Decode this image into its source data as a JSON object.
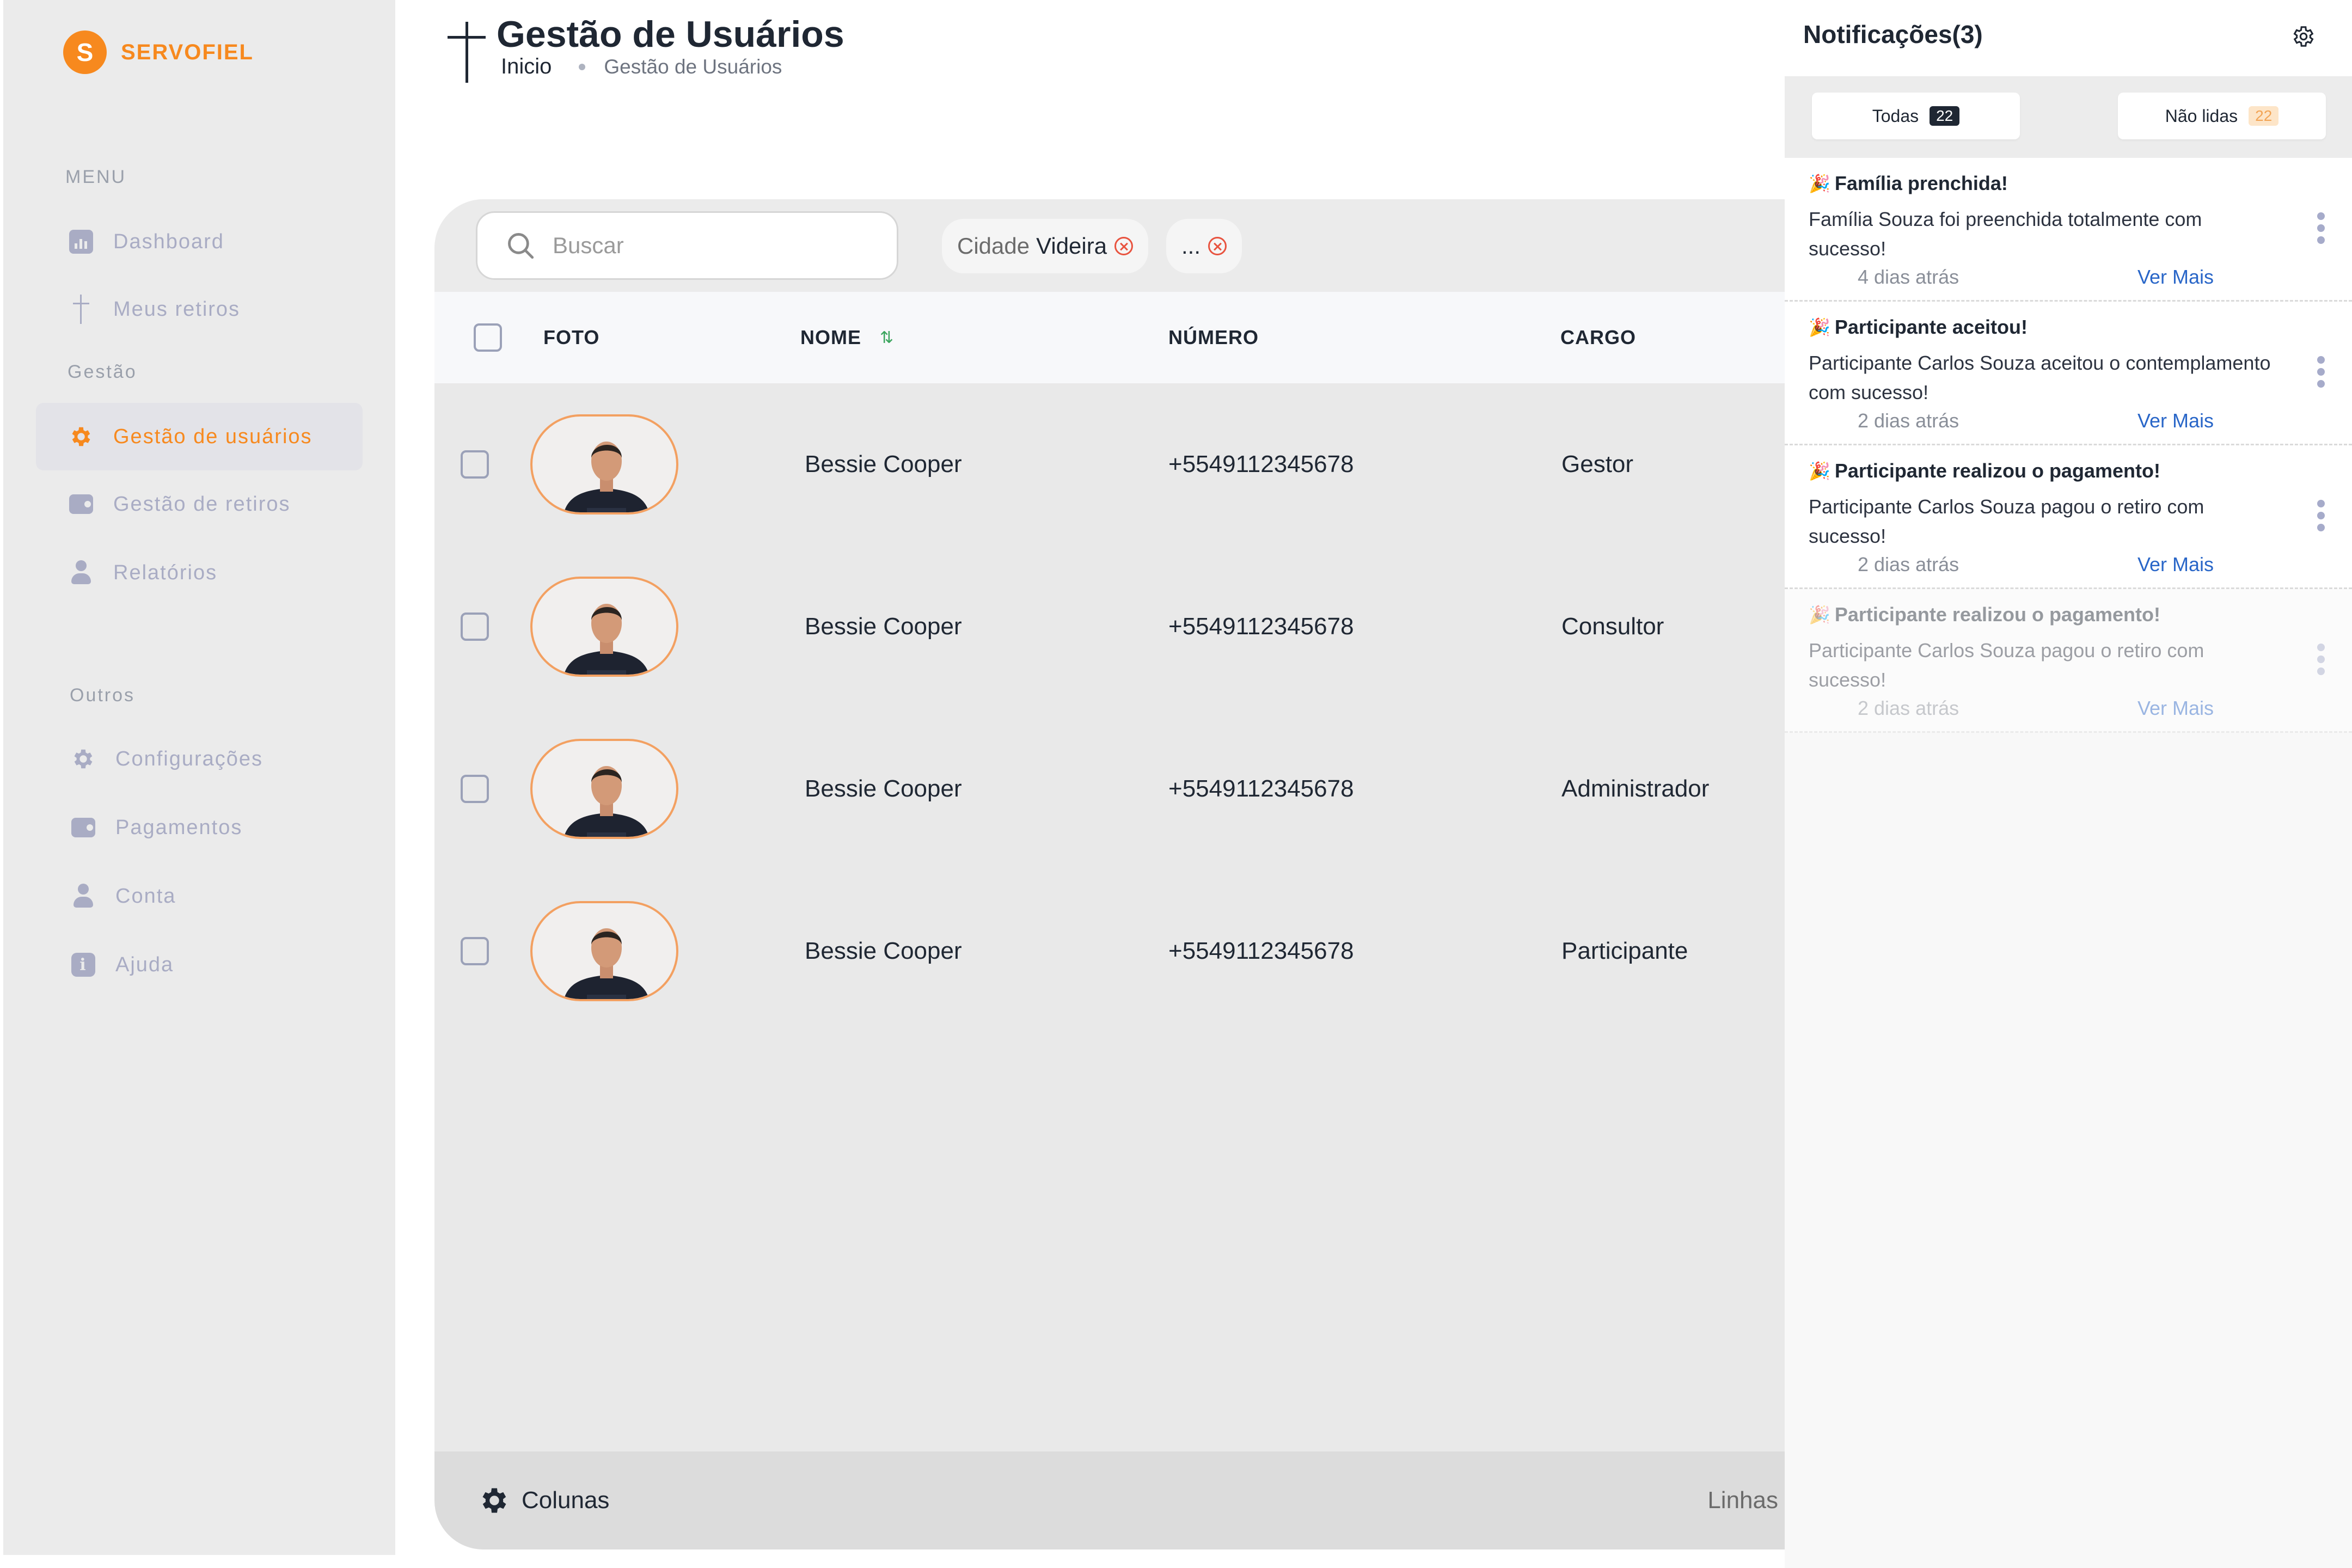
{
  "brand": {
    "initial": "S",
    "name": "SERVOFIEL"
  },
  "sidebar": {
    "menu_label": "MENU",
    "gestao_label": "Gestão",
    "outros_label": "Outros",
    "items": [
      {
        "label": "Dashboard",
        "icon": "chart-icon"
      },
      {
        "label": "Meus retiros",
        "icon": "cross-icon"
      },
      {
        "label": "Gestão de usuários",
        "icon": "gear-icon",
        "active": true
      },
      {
        "label": "Gestão de retiros",
        "icon": "wallet-icon"
      },
      {
        "label": "Relatórios",
        "icon": "user-icon"
      },
      {
        "label": "Configurações",
        "icon": "gear-icon"
      },
      {
        "label": "Pagamentos",
        "icon": "wallet-icon"
      },
      {
        "label": "Conta",
        "icon": "user-icon"
      },
      {
        "label": "Ajuda",
        "icon": "info-icon"
      }
    ]
  },
  "header": {
    "title": "Gestão de Usuários",
    "breadcrumb": {
      "home": "Inicio",
      "current": "Gestão de Usuários"
    }
  },
  "toolbar": {
    "search_placeholder": "Buscar",
    "filters": [
      {
        "key": "Cidade",
        "value": "Videira"
      },
      {
        "key": "",
        "value": "..."
      }
    ]
  },
  "table": {
    "columns": [
      "FOTO",
      "NOME",
      "NÚMERO",
      "CARGO"
    ],
    "rows": [
      {
        "name": "Bessie Cooper",
        "number": "+5549112345678",
        "role": "Gestor"
      },
      {
        "name": "Bessie Cooper",
        "number": "+5549112345678",
        "role": "Consultor"
      },
      {
        "name": "Bessie Cooper",
        "number": "+5549112345678",
        "role": "Administrador"
      },
      {
        "name": "Bessie Cooper",
        "number": "+5549112345678",
        "role": "Participante"
      }
    ]
  },
  "footer": {
    "columns_label": "Colunas",
    "lines_label": "Linhas"
  },
  "notifications": {
    "title": "Notificações(3)",
    "tabs": [
      {
        "label": "Todas",
        "count": "22"
      },
      {
        "label": "Não lidas",
        "count": "22"
      }
    ],
    "items": [
      {
        "icon": "🎉",
        "title": "Família prenchida!",
        "body": "Família Souza foi preenchida totalmente com sucesso!",
        "time": "4 dias atrás",
        "more": "Ver Mais"
      },
      {
        "icon": "🎉",
        "title": "Participante aceitou!",
        "body": "Participante Carlos Souza aceitou o contemplamento com  sucesso!",
        "time": "2 dias atrás",
        "more": "Ver Mais"
      },
      {
        "icon": "🎉",
        "title": "Participante realizou o pagamento!",
        "body": "Participante Carlos Souza pagou o retiro com sucesso!",
        "time": "2 dias atrás",
        "more": "Ver Mais"
      },
      {
        "icon": "🎉",
        "title": "Participante realizou o pagamento!",
        "body": "Participante Carlos Souza pagou o retiro com sucesso!",
        "time": "2 dias atrás",
        "more": "Ver Mais"
      }
    ]
  },
  "colors": {
    "accent": "#f7891e",
    "link": "#2966c8",
    "nav_inactive": "#a9acc4"
  }
}
